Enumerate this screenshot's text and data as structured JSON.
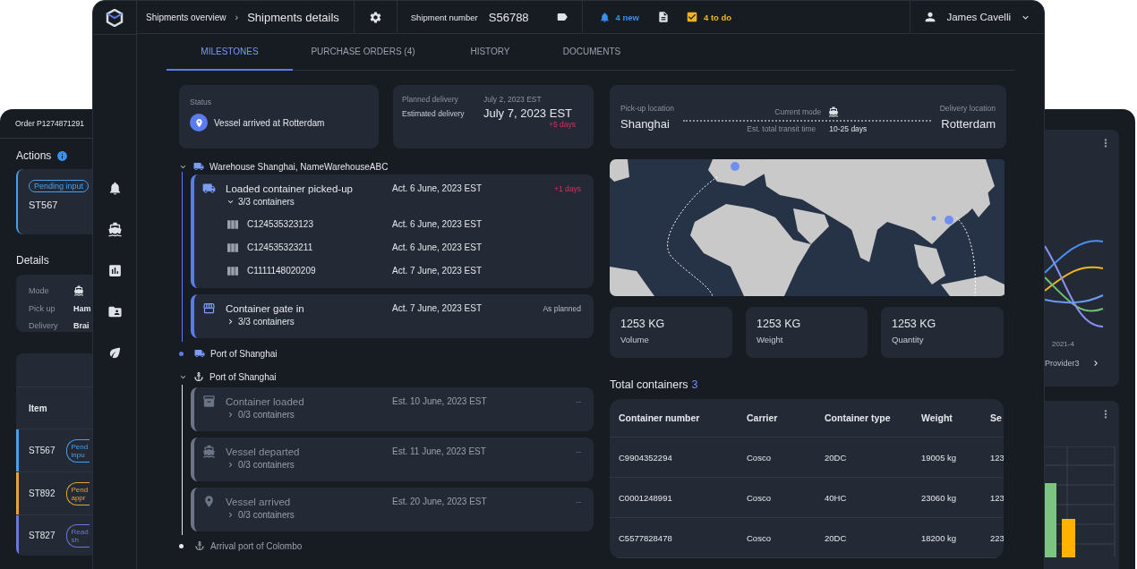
{
  "back_left_window": {
    "title": "Order P1274871291",
    "actions_heading": "Actions",
    "action_card": {
      "badge": "Pending input",
      "item": "ST567"
    },
    "details_heading": "Details",
    "details": [
      {
        "label": "Mode",
        "kind": "icon"
      },
      {
        "label": "Pick up",
        "kind": "text",
        "value": "Ham"
      },
      {
        "label": "Delivery",
        "kind": "text",
        "value": "Brai"
      }
    ],
    "table_header": "Item",
    "rows": [
      {
        "item": "ST567",
        "badge": "Pend inpu",
        "color": "#4a9eea"
      },
      {
        "item": "ST892",
        "badge": "Pend appr",
        "color": "#e8a23a"
      },
      {
        "item": "ST827",
        "badge": "Read sh",
        "color": "#6a78d8"
      }
    ]
  },
  "back_right_window": {
    "axis_label": "2021-4",
    "legend": "Provider3"
  },
  "main_window": {
    "breadcrumb": {
      "parent": "Shipments overview",
      "separator": "›",
      "current": "Shipments details"
    },
    "shipment": {
      "label": "Shipment number",
      "value": "S56788"
    },
    "notifications": {
      "count": "4 new",
      "todo": "4 to do"
    },
    "user": "James Cavelli",
    "rail": [
      {
        "kind": "bell",
        "selected": false
      },
      {
        "kind": "ship",
        "selected": false
      },
      {
        "kind": "chart",
        "selected": false
      },
      {
        "kind": "folder",
        "selected": false
      },
      {
        "kind": "leaf",
        "selected": false
      }
    ],
    "tabs": [
      {
        "label": "MILESTONES",
        "selected": true
      },
      {
        "label": "PURCHASE ORDERS (4)",
        "selected": false
      },
      {
        "label": "HISTORY",
        "selected": false
      },
      {
        "label": "DOCUMENTS",
        "selected": false
      }
    ],
    "status": {
      "label": "Status",
      "value": "Vessel arrived at Rotterdam"
    },
    "delivery": {
      "planned_label": "Planned delivery",
      "planned": "July 2, 2023 EST",
      "estimated_label": "Estimated delivery",
      "estimated": "July 7, 2023 EST",
      "delay": "+5 days"
    },
    "timeline": [
      {
        "kind": "stop",
        "by_road": true,
        "label": "Warehouse Shanghai, NameWarehouseABC",
        "expanded": true,
        "reached": true,
        "events": [
          {
            "kind": "pickup",
            "title": "Loaded container picked-up",
            "date": "Act. 6 June, 2023 EST",
            "note": "+1 days",
            "late": true,
            "reached": true,
            "containers_label": "3/3 containers",
            "expanded": true,
            "containers": [
              {
                "id": "C124535323123",
                "date": "Act. 6 June, 2023 EST"
              },
              {
                "id": "C124535323211",
                "date": "Act. 6 June, 2023 EST"
              },
              {
                "id": "C1111148020209",
                "date": "Act. 7 June, 2023 EST"
              }
            ]
          },
          {
            "kind": "gate",
            "title": "Container gate in",
            "date": "Act. 7 June, 2023 EST",
            "note": "As planned",
            "late": false,
            "reached": true,
            "containers_label": "3/3 containers",
            "expanded": false
          }
        ]
      },
      {
        "kind": "point",
        "by_road": true,
        "label": "Port of Shanghai",
        "reached": true
      },
      {
        "kind": "stop",
        "by_road": false,
        "label": "Port of Shanghai",
        "expanded": true,
        "reached": false,
        "events": [
          {
            "kind": "loading",
            "title": "Container loaded",
            "date": "Est. 10 June, 2023 EST",
            "note": "--",
            "late": false,
            "reached": false,
            "containers_label": "0/3 containers",
            "expanded": false
          },
          {
            "kind": "departure",
            "title": "Vessel departed",
            "date": "Est. 11 June, 2023 EST",
            "note": "--",
            "late": false,
            "reached": false,
            "containers_label": "0/3 containers",
            "expanded": false
          },
          {
            "kind": "arrival",
            "title": "Vessel arrived",
            "date": "Est. 20 June, 2023 EST",
            "note": "--",
            "late": false,
            "reached": false,
            "containers_label": "0/3 containers",
            "expanded": false
          }
        ]
      },
      {
        "kind": "point",
        "by_road": false,
        "label": "Arrival port of Colombo",
        "reached": false
      }
    ],
    "route": {
      "from_label": "Pick-up location",
      "from": "Shanghai",
      "mode_label": "Current mode",
      "transit_label": "Est. total transit time",
      "transit": "10-25 days",
      "to_label": "Delivery location",
      "to": "Rotterdam"
    },
    "stats": [
      {
        "value": "1253 KG",
        "label": "Volume"
      },
      {
        "value": "1253 KG",
        "label": "Weight"
      },
      {
        "value": "1253 KG",
        "label": "Quantity"
      }
    ],
    "containers_title": "Total containers",
    "containers_count": "3",
    "table": {
      "columns": [
        "Container number",
        "Carrier",
        "Container type",
        "Weight",
        "Se"
      ],
      "rows": [
        [
          "C9904352294",
          "Cosco",
          "20DC",
          "19005 kg",
          "123"
        ],
        [
          "C0001248991",
          "Cosco",
          "40HC",
          "23060 kg",
          "123"
        ],
        [
          "C5577828478",
          "Cosco",
          "20DC",
          "18200 kg",
          "223"
        ]
      ]
    }
  }
}
